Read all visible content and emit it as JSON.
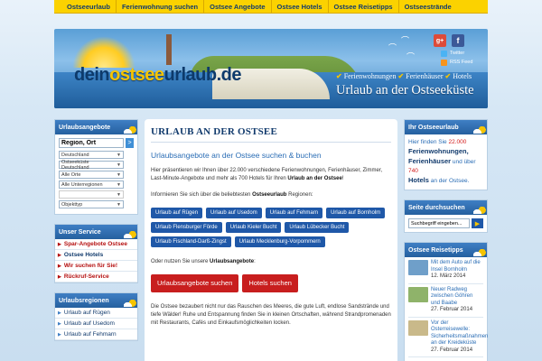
{
  "topnav": [
    "Ostseeurlaub",
    "Ferienwohnung suchen",
    "Ostsee Angebote",
    "Ostsee Hotels",
    "Ostsee Reisetipps",
    "Ostseestrände"
  ],
  "header": {
    "logo_part1": "dein",
    "logo_part2": "ostsee",
    "logo_part3": "urlaub",
    "logo_part4": ".de",
    "social_gplus": "g+",
    "social_fb": "f",
    "twitter": "Twitter",
    "rss": "RSS Feed",
    "tag1": "Ferienwohnungen",
    "tag2": "Ferienhäuser",
    "tag3": "Hotels",
    "slogan": "Urlaub an der Ostseeküste"
  },
  "left": {
    "offers_title": "Urlaubsangebote",
    "search_value": "Region, Ort",
    "go_label": ">",
    "selects": [
      "Deutschland",
      "Ostseeküste Deutschland",
      "Alle Orte",
      "Alle Unterregionen",
      "",
      "Objekttyp"
    ],
    "service_title": "Unser Service",
    "service_items": [
      "Spar-Angebote Ostsee",
      "Ostsee Hotels",
      "Wir suchen für Sie!",
      "Rückruf-Service"
    ],
    "regions_title": "Urlaubsregionen",
    "region_items": [
      "Urlaub auf Rügen",
      "Urlaub auf Usedom",
      "Urlaub auf Fehmarn"
    ]
  },
  "main": {
    "title": "URLAUB AN DER OSTSEE",
    "subtitle": "Urlaubsangebote an der Ostsee suchen & buchen",
    "intro_a": "Hier präsentieren wir Ihnen über 22.000 verschiedene Ferienwohnungen, Ferienhäuser, Zimmer, Last-Minute-Angebote und mehr als 700 Hotels für Ihren ",
    "intro_b": "Urlaub an der Ostsee",
    "intro_c": "!",
    "inform_a": "Informieren Sie sich über die beliebtesten ",
    "inform_b": "Ostseeurlaub",
    "inform_c": " Regionen:",
    "region_buttons": [
      "Urlaub auf Rügen",
      "Urlaub auf Usedom",
      "Urlaub auf Fehmarn",
      "Urlaub auf Bornholm",
      "Urlaub Flensburger Förde",
      "Urlaub Kieler Bucht",
      "Urlaub Lübecker Bucht",
      "Urlaub Fischland-Darß-Zingst",
      "Urlaub Mecklenburg-Vorpommern"
    ],
    "or_a": "Oder nutzen Sie unsere ",
    "or_b": "Urlaubsangebote",
    "or_c": ":",
    "btn_offers": "Urlaubsangebote suchen",
    "btn_hotels": "Hotels suchen",
    "bottom_text": "Die Ostsee bezaubert nicht nur das Rauschen des Meeres, die gute Luft, endlose Sandstrände und tiefe Wälder! Ruhe und Entspannung finden Sie in kleinen Ortschaften, während Strandpromenaden mit Restaurants, Cafés und Einkaufsmöglichkeiten locken."
  },
  "right": {
    "your_title": "Ihr Ostseeurlaub",
    "your_l1": "Hier finden Sie ",
    "your_n1": "22.000",
    "your_b1": "Ferienwohnungen,",
    "your_b2": "Ferienhäuser",
    "your_l2": " und über ",
    "your_n2": "740",
    "your_b3": "Hotels",
    "your_l3": " an der Ostsee.",
    "search_title": "Seite durchsuchen",
    "search_value": "Suchbegriff eingeben...",
    "search_go": "▶",
    "tips_title": "Ostsee Reisetipps",
    "tips": [
      {
        "text": "Mit dem Auto auf die Insel Bornholm",
        "date": "12. März 2014",
        "color": "#6f9fc9"
      },
      {
        "text": "Neuer Radweg zwischen Göhren und Baabe",
        "date": "27. Februar 2014",
        "color": "#8fb36a"
      },
      {
        "text": "Vor der Osterreisewelle: Sicherheitsmaßnahmen an der Kreideküste",
        "date": "27. Februar 2014",
        "color": "#c9b98a"
      }
    ]
  }
}
